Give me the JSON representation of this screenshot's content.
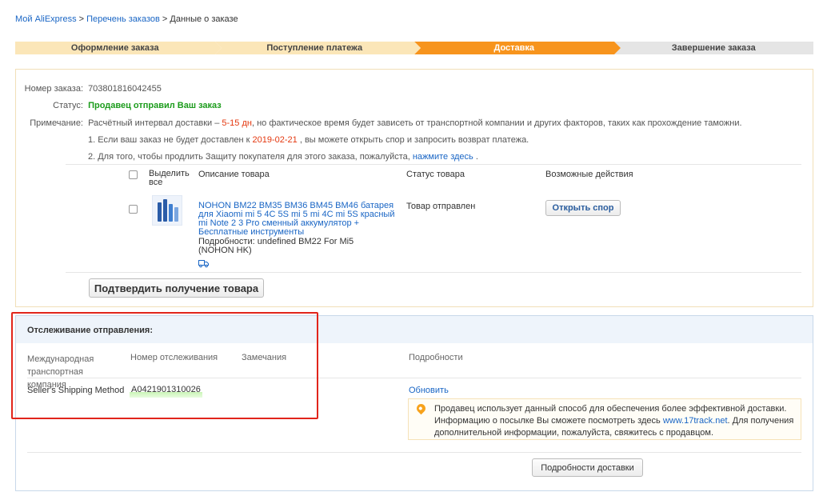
{
  "breadcrumb": {
    "home": "Мой AliExpress",
    "sep1": " > ",
    "orders": "Перечень заказов",
    "sep2": " > ",
    "current": "Данные о заказе"
  },
  "steps": [
    "Оформление заказа",
    "Поступление платежа",
    "Доставка",
    "Завершение заказа"
  ],
  "order": {
    "number_label": "Номер заказа:",
    "number": "703801816042455",
    "status_label": "Статус:",
    "status": "Продавец отправил Ваш заказ",
    "note_label": "Примечание:",
    "note_a": "Расчётный интервал доставки – ",
    "note_days": "5-15 дн",
    "note_b": ", но фактическое время будет зависеть от транспортной компании и других факторов, таких как прохождение таможни.",
    "line1_a": "1. Если ваш заказ не будет доставлен к ",
    "line1_date": "2019-02-21",
    "line1_b": " , вы можете открыть спор и запросить возврат платежа.",
    "line2_a": "2. Для того, чтобы продлить Защиту покупателя для этого заказа, пожалуйста, ",
    "line2_link": "нажмите здесь",
    "line2_b": " ."
  },
  "items_table": {
    "headers": {
      "select_all": "Выделить все",
      "description": "Описание товара",
      "status": "Статус товара",
      "actions": "Возможные действия"
    },
    "product": {
      "title": "NOHON BM22 BM35 BM36 BM45 BM46 батарея для Xiaomi mi 5 4C 5S mi 5 mi 4C mi 5S красный mi Note 2 3 Pro сменный аккумулятор + Бесплатные инструменты",
      "details": "Подробности: undefined BM22 For Mi5",
      "seller": "(NOHON HK)",
      "status": "Товар отправлен",
      "dispute_button": "Открыть спор"
    },
    "confirm_button": "Подтвердить получение товара"
  },
  "tracking": {
    "title": "Отслеживание отправления:",
    "headers": {
      "company": "Международная транспортная компания",
      "number": "Номер отслеживания",
      "remarks": "Замечания",
      "details": "Подробности"
    },
    "row": {
      "company": "Seller's Shipping Method",
      "number": "A0421901310026",
      "refresh": "Обновить"
    },
    "note_a": "Продавец использует данный способ для обеспечения более эффективной доставки. Информацию о посылке Вы сможете посмотреть здесь ",
    "note_link": "www.17track.net",
    "note_b": ". Для получения дополнительной информации, пожалуйста, свяжитесь с продавцом.",
    "details_button": "Подробности доставки"
  },
  "colors": {
    "accent": "#f7941d",
    "status_green": "#1c9c1c",
    "highlight_red": "#e4380f",
    "link_blue": "#1a66c5",
    "annotation_red": "#e1251b"
  }
}
